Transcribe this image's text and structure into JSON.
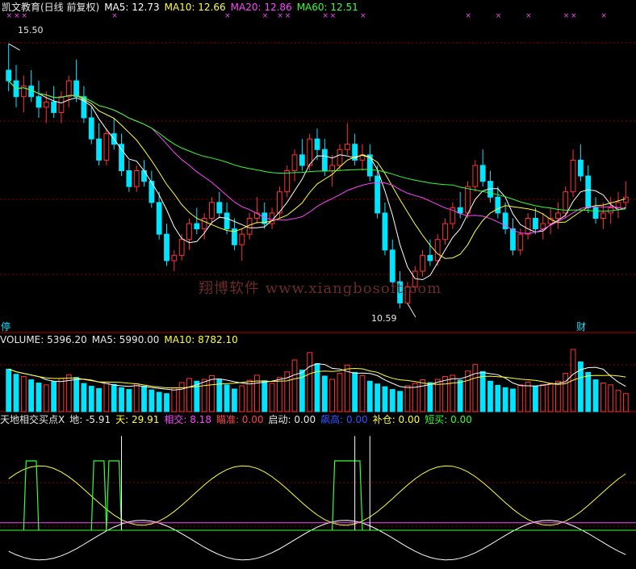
{
  "header_price": {
    "title": "凯文教育(日线 前复权)",
    "ma5": "MA5: 12.73",
    "ma10": "MA10: 12.66",
    "ma20": "MA20: 12.86",
    "ma60": "MA60: 12.51"
  },
  "header_volume": {
    "title": "VOLUME: 5396.20",
    "ma5": "MA5: 5990.00",
    "ma10": "MA10: 8782.10"
  },
  "header_indicator": {
    "title": "天地相交买点X",
    "di": "地: -5.91",
    "tian": "天: 29.91",
    "xiangjiao": "相交: 8.18",
    "miaozhun": "瞄准: 0.00",
    "qidong": "启动: 0.00",
    "shanggao": "飙高: 0.00",
    "bucang": "补仓: 0.00",
    "duanmai": "短买: 0.00"
  },
  "annotations": {
    "high_label": "15.50",
    "low_label": "10.59",
    "flag_left": "停",
    "flag_right": "财"
  },
  "watermark": "翔博软件 www.xiangbosoft.com",
  "colors": {
    "up": "#ff3333",
    "down": "#00e5ff",
    "ma5": "#ffffff",
    "ma10": "#ffff33",
    "ma20": "#ff44ff",
    "ma60": "#33ff33",
    "grid": "#8b0000",
    "x_marker": "#ff44ff"
  },
  "chart_data": {
    "type": "candlestick",
    "price_range": [
      10.3,
      15.9
    ],
    "candles": [
      [
        15.0,
        15.5,
        14.6,
        14.8
      ],
      [
        14.8,
        15.1,
        14.3,
        14.5
      ],
      [
        14.5,
        14.9,
        14.2,
        14.7
      ],
      [
        14.7,
        15.0,
        14.4,
        14.5
      ],
      [
        14.5,
        14.8,
        14.1,
        14.3
      ],
      [
        14.3,
        14.6,
        14.0,
        14.4
      ],
      [
        14.4,
        14.7,
        14.1,
        14.2
      ],
      [
        14.2,
        14.6,
        14.0,
        14.5
      ],
      [
        14.5,
        14.9,
        14.3,
        14.8
      ],
      [
        14.8,
        15.2,
        14.4,
        14.5
      ],
      [
        14.5,
        14.7,
        14.0,
        14.1
      ],
      [
        14.1,
        14.3,
        13.6,
        13.7
      ],
      [
        13.7,
        14.0,
        13.2,
        13.3
      ],
      [
        13.3,
        13.9,
        13.2,
        13.8
      ],
      [
        13.8,
        14.1,
        13.5,
        13.6
      ],
      [
        13.6,
        13.8,
        13.0,
        13.1
      ],
      [
        13.1,
        13.3,
        12.7,
        12.8
      ],
      [
        12.8,
        13.2,
        12.7,
        13.1
      ],
      [
        13.1,
        13.3,
        12.8,
        12.9
      ],
      [
        12.9,
        13.1,
        12.4,
        12.5
      ],
      [
        12.5,
        12.7,
        11.8,
        11.9
      ],
      [
        11.9,
        12.1,
        11.3,
        11.4
      ],
      [
        11.4,
        11.6,
        11.2,
        11.5
      ],
      [
        11.5,
        11.9,
        11.4,
        11.8
      ],
      [
        11.8,
        12.2,
        11.6,
        12.1
      ],
      [
        12.1,
        12.4,
        11.9,
        12.0
      ],
      [
        12.0,
        12.3,
        11.8,
        12.2
      ],
      [
        12.2,
        12.6,
        12.1,
        12.5
      ],
      [
        12.5,
        12.7,
        12.2,
        12.3
      ],
      [
        12.3,
        12.5,
        11.9,
        12.0
      ],
      [
        12.0,
        12.2,
        11.6,
        11.7
      ],
      [
        11.7,
        12.0,
        11.4,
        11.9
      ],
      [
        11.9,
        12.3,
        11.8,
        12.2
      ],
      [
        12.2,
        12.6,
        12.1,
        12.3
      ],
      [
        12.3,
        12.5,
        12.0,
        12.1
      ],
      [
        12.1,
        12.4,
        12.0,
        12.3
      ],
      [
        12.3,
        12.8,
        12.2,
        12.7
      ],
      [
        12.7,
        13.2,
        12.6,
        13.1
      ],
      [
        13.1,
        13.5,
        12.9,
        13.4
      ],
      [
        13.4,
        13.7,
        13.1,
        13.2
      ],
      [
        13.2,
        13.8,
        13.1,
        13.7
      ],
      [
        13.7,
        13.9,
        13.3,
        13.5
      ],
      [
        13.5,
        13.7,
        13.0,
        13.1
      ],
      [
        13.1,
        13.4,
        12.8,
        13.2
      ],
      [
        13.2,
        13.6,
        13.1,
        13.5
      ],
      [
        13.5,
        14.0,
        13.4,
        13.6
      ],
      [
        13.6,
        13.8,
        13.2,
        13.3
      ],
      [
        13.3,
        13.6,
        13.1,
        13.4
      ],
      [
        13.4,
        13.6,
        12.9,
        13.0
      ],
      [
        13.0,
        13.2,
        12.2,
        12.3
      ],
      [
        12.3,
        12.5,
        11.5,
        11.6
      ],
      [
        11.6,
        11.8,
        10.9,
        11.0
      ],
      [
        11.0,
        11.2,
        10.5,
        10.6
      ],
      [
        10.6,
        11.0,
        10.59,
        10.9
      ],
      [
        10.9,
        11.3,
        10.8,
        11.2
      ],
      [
        11.2,
        11.6,
        11.1,
        11.5
      ],
      [
        11.5,
        11.8,
        11.3,
        11.4
      ],
      [
        11.4,
        11.9,
        11.3,
        11.8
      ],
      [
        11.8,
        12.2,
        11.7,
        12.1
      ],
      [
        12.1,
        12.5,
        12.0,
        12.4
      ],
      [
        12.4,
        12.7,
        12.2,
        12.3
      ],
      [
        12.3,
        12.9,
        12.2,
        12.8
      ],
      [
        12.8,
        13.3,
        12.7,
        13.2
      ],
      [
        13.2,
        13.5,
        12.8,
        12.9
      ],
      [
        12.9,
        13.1,
        12.5,
        12.6
      ],
      [
        12.6,
        12.8,
        12.2,
        12.3
      ],
      [
        12.3,
        12.5,
        11.9,
        12.0
      ],
      [
        12.0,
        12.2,
        11.5,
        11.6
      ],
      [
        11.6,
        12.0,
        11.5,
        11.9
      ],
      [
        11.9,
        12.3,
        11.8,
        12.2
      ],
      [
        12.2,
        12.4,
        11.9,
        12.0
      ],
      [
        12.0,
        12.3,
        11.8,
        12.1
      ],
      [
        12.1,
        12.4,
        11.9,
        12.2
      ],
      [
        12.2,
        12.5,
        12.0,
        12.3
      ],
      [
        12.3,
        12.8,
        12.2,
        12.7
      ],
      [
        12.7,
        13.5,
        12.6,
        13.3
      ],
      [
        13.3,
        13.6,
        12.9,
        13.0
      ],
      [
        13.0,
        13.2,
        12.3,
        12.4
      ],
      [
        12.4,
        12.6,
        12.1,
        12.2
      ],
      [
        12.2,
        12.5,
        12.0,
        12.3
      ],
      [
        12.3,
        12.6,
        12.1,
        12.4
      ],
      [
        12.4,
        12.7,
        12.2,
        12.5
      ],
      [
        12.5,
        12.9,
        12.4,
        12.6
      ]
    ],
    "volume": [
      9.2,
      8.1,
      7.6,
      6.9,
      6.2,
      5.8,
      6.5,
      7.2,
      8.0,
      7.4,
      6.1,
      5.5,
      5.0,
      6.4,
      5.9,
      5.2,
      4.8,
      6.0,
      5.5,
      4.7,
      4.2,
      3.9,
      5.1,
      6.3,
      7.2,
      6.6,
      7.0,
      7.8,
      6.9,
      5.8,
      4.9,
      5.6,
      6.8,
      7.9,
      6.7,
      6.1,
      7.4,
      8.6,
      11.2,
      9.0,
      12.8,
      10.4,
      7.7,
      7.0,
      8.3,
      10.1,
      8.5,
      7.8,
      6.6,
      6.0,
      5.4,
      4.8,
      4.4,
      5.6,
      6.1,
      6.9,
      6.3,
      7.0,
      7.6,
      7.9,
      6.8,
      8.8,
      10.2,
      8.7,
      6.6,
      5.7,
      5.2,
      4.9,
      5.8,
      6.4,
      5.5,
      5.9,
      6.2,
      6.6,
      8.3,
      13.5,
      10.8,
      8.5,
      6.9,
      6.2,
      5.8,
      4.6,
      3.9
    ],
    "volume_range": [
      0,
      14
    ],
    "indicator_range": [
      -15,
      42
    ]
  }
}
